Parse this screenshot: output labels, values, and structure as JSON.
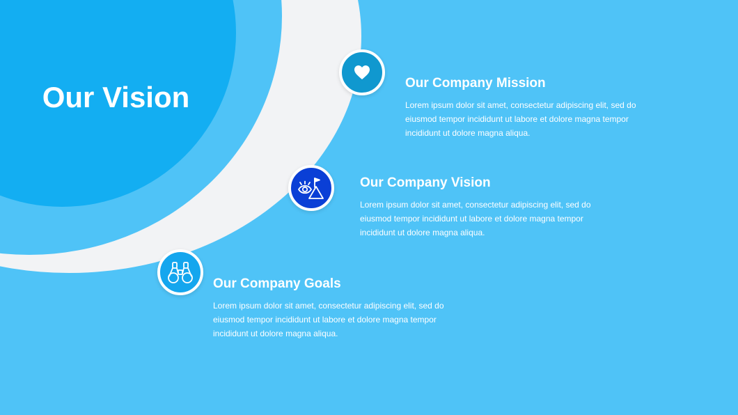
{
  "slide": {
    "title": "Our Vision",
    "colors": {
      "background": "#4fc3f7",
      "ring": "#f2f3f5",
      "core": "#13aef2",
      "text": "#ffffff"
    }
  },
  "items": [
    {
      "heading": "Our Company Mission",
      "body": "Lorem ipsum dolor sit amet, consectetur adipiscing elit, sed do eiusmod tempor incididunt ut labore et dolore magna tempor incididunt ut dolore magna aliqua.",
      "icon": "heart-icon",
      "color": "#1098cf"
    },
    {
      "heading": "Our Company Vision",
      "body": "Lorem ipsum dolor sit amet, consectetur adipiscing elit, sed do eiusmod tempor incididunt ut labore et dolore magna tempor incididunt ut dolore magna aliqua.",
      "icon": "eye-mountain-flag-icon",
      "color": "#0a3fd6"
    },
    {
      "heading": "Our Company Goals",
      "body": "Lorem ipsum dolor sit amet, consectetur adipiscing elit, sed do eiusmod tempor incididunt ut labore et dolore magna tempor incididunt ut dolore magna aliqua.",
      "icon": "binoculars-icon",
      "color": "#14a6ee"
    }
  ]
}
